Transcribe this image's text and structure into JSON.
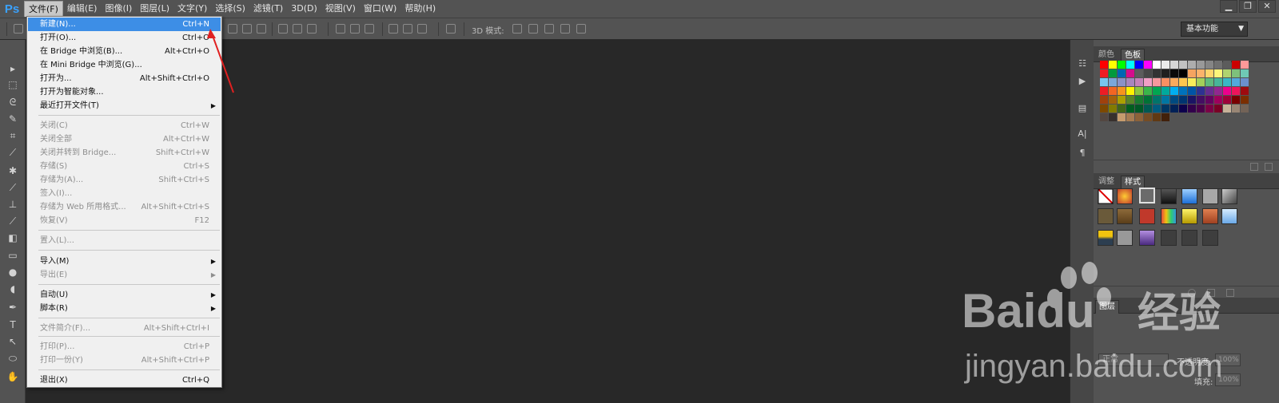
{
  "app": {
    "logo": "Ps"
  },
  "menubar": {
    "items": [
      "文件(F)",
      "编辑(E)",
      "图像(I)",
      "图层(L)",
      "文字(Y)",
      "选择(S)",
      "滤镜(T)",
      "3D(D)",
      "视图(V)",
      "窗口(W)",
      "帮助(H)"
    ],
    "window_controls": [
      "minimize",
      "restore",
      "close"
    ]
  },
  "options_bar": {
    "mode_3d_label": "3D 模式:",
    "workspace": "基本功能"
  },
  "file_menu": {
    "items": [
      {
        "label": "新建(N)...",
        "shortcut": "Ctrl+N",
        "state": "highlighted"
      },
      {
        "label": "打开(O)...",
        "shortcut": "Ctrl+O",
        "state": "enabled"
      },
      {
        "label": "在 Bridge 中浏览(B)...",
        "shortcut": "Alt+Ctrl+O",
        "state": "enabled"
      },
      {
        "label": "在 Mini Bridge 中浏览(G)...",
        "shortcut": "",
        "state": "enabled"
      },
      {
        "label": "打开为...",
        "shortcut": "Alt+Shift+Ctrl+O",
        "state": "enabled"
      },
      {
        "label": "打开为智能对象...",
        "shortcut": "",
        "state": "enabled"
      },
      {
        "label": "最近打开文件(T)",
        "shortcut": "",
        "state": "enabled",
        "submenu": true
      },
      {
        "label": "关闭(C)",
        "shortcut": "Ctrl+W",
        "state": "disabled"
      },
      {
        "label": "关闭全部",
        "shortcut": "Alt+Ctrl+W",
        "state": "disabled"
      },
      {
        "label": "关闭并转到 Bridge...",
        "shortcut": "Shift+Ctrl+W",
        "state": "disabled"
      },
      {
        "label": "存储(S)",
        "shortcut": "Ctrl+S",
        "state": "disabled"
      },
      {
        "label": "存储为(A)...",
        "shortcut": "Shift+Ctrl+S",
        "state": "disabled"
      },
      {
        "label": "签入(I)...",
        "shortcut": "",
        "state": "disabled"
      },
      {
        "label": "存储为 Web 所用格式...",
        "shortcut": "Alt+Shift+Ctrl+S",
        "state": "disabled"
      },
      {
        "label": "恢复(V)",
        "shortcut": "F12",
        "state": "disabled"
      },
      {
        "label": "置入(L)...",
        "shortcut": "",
        "state": "disabled"
      },
      {
        "label": "导入(M)",
        "shortcut": "",
        "state": "enabled",
        "submenu": true
      },
      {
        "label": "导出(E)",
        "shortcut": "",
        "state": "disabled",
        "submenu": true
      },
      {
        "label": "自动(U)",
        "shortcut": "",
        "state": "enabled",
        "submenu": true
      },
      {
        "label": "脚本(R)",
        "shortcut": "",
        "state": "enabled",
        "submenu": true
      },
      {
        "label": "文件简介(F)...",
        "shortcut": "Alt+Shift+Ctrl+I",
        "state": "disabled"
      },
      {
        "label": "打印(P)...",
        "shortcut": "Ctrl+P",
        "state": "disabled"
      },
      {
        "label": "打印一份(Y)",
        "shortcut": "Alt+Shift+Ctrl+P",
        "state": "disabled"
      },
      {
        "label": "退出(X)",
        "shortcut": "Ctrl+Q",
        "state": "enabled"
      }
    ]
  },
  "toolbar": {
    "tools": [
      "move-tool",
      "marquee-tool",
      "lasso-tool",
      "quick-select-tool",
      "crop-tool",
      "eyedropper-tool",
      "healing-tool",
      "brush-tool",
      "stamp-tool",
      "history-brush-tool",
      "eraser-tool",
      "gradient-tool",
      "blur-tool",
      "dodge-tool",
      "pen-tool",
      "type-tool",
      "path-select-tool",
      "shape-tool",
      "hand-tool"
    ]
  },
  "panels": {
    "color": {
      "tabs": [
        "颜色",
        "色板"
      ],
      "active": 1
    },
    "adjust": {
      "tabs": [
        "调整",
        "样式"
      ],
      "active": 1
    },
    "layers": {
      "tab_partial": "图层",
      "blend_mode": "正常",
      "opacity_label": "不透明度:",
      "opacity_value": "100%",
      "fill_label": "填充:",
      "fill_value": "100%"
    }
  },
  "swatch_colors": [
    [
      "#ff0000",
      "#ffff00",
      "#00ff00",
      "#00ffff",
      "#0000ff",
      "#ff00ff",
      "#ffffff",
      "#ebebeb",
      "#d6d6d6",
      "#c2c2c2",
      "#adadad",
      "#999999",
      "#858585",
      "#707070",
      "#5c5c5c",
      "#cc0000",
      "#ff9999"
    ],
    [
      "#ee1d24",
      "#009a3d",
      "#0066b3",
      "#d40e8c",
      "#5c5c5c",
      "#474747",
      "#333333",
      "#1f1f1f",
      "#0a0a0a",
      "#000000",
      "#f4a460",
      "#fbb36b",
      "#fed56c",
      "#fdf57a",
      "#b0d36f",
      "#7ec17b",
      "#6fc8b5"
    ],
    [
      "#79c7ef",
      "#7ba7d9",
      "#8b91c7",
      "#a886bd",
      "#c583b9",
      "#f29fc5",
      "#f6989d",
      "#fa8f62",
      "#fbaa5d",
      "#fdc64f",
      "#f9ec5a",
      "#a2cf5a",
      "#5fba7d",
      "#47b699",
      "#3ab7c5",
      "#53a9dc",
      "#6b90cc"
    ],
    [
      "#ed1c24",
      "#f26522",
      "#f7941d",
      "#fff200",
      "#8dc63f",
      "#39b54a",
      "#00a651",
      "#00a99d",
      "#00aeef",
      "#0072bc",
      "#0054a6",
      "#2e3192",
      "#662d91",
      "#92278f",
      "#ec008c",
      "#ed145b",
      "#9e0b0f"
    ],
    [
      "#a0410d",
      "#a3620a",
      "#aba000",
      "#598527",
      "#197b30",
      "#007236",
      "#00746b",
      "#0076a3",
      "#004a80",
      "#003471",
      "#1b1464",
      "#440e62",
      "#630460",
      "#9e005d",
      "#9e0039",
      "#790000",
      "#7b2e00"
    ],
    [
      "#7d4900",
      "#827b00",
      "#406618",
      "#005e20",
      "#005826",
      "#005952",
      "#005b7f",
      "#003663",
      "#002157",
      "#0d004c",
      "#32004b",
      "#4b0049",
      "#7b0046",
      "#7a0026",
      "#c7b299",
      "#998675",
      "#736357"
    ],
    [
      "#534741",
      "#37302d",
      "#c69c6e",
      "#a67c52",
      "#8c6239",
      "#754c24",
      "#603913",
      "#42210b"
    ]
  ],
  "watermark": {
    "brand": "Baidu",
    "suffix": "经验",
    "url": "jingyan.baidu.com"
  }
}
